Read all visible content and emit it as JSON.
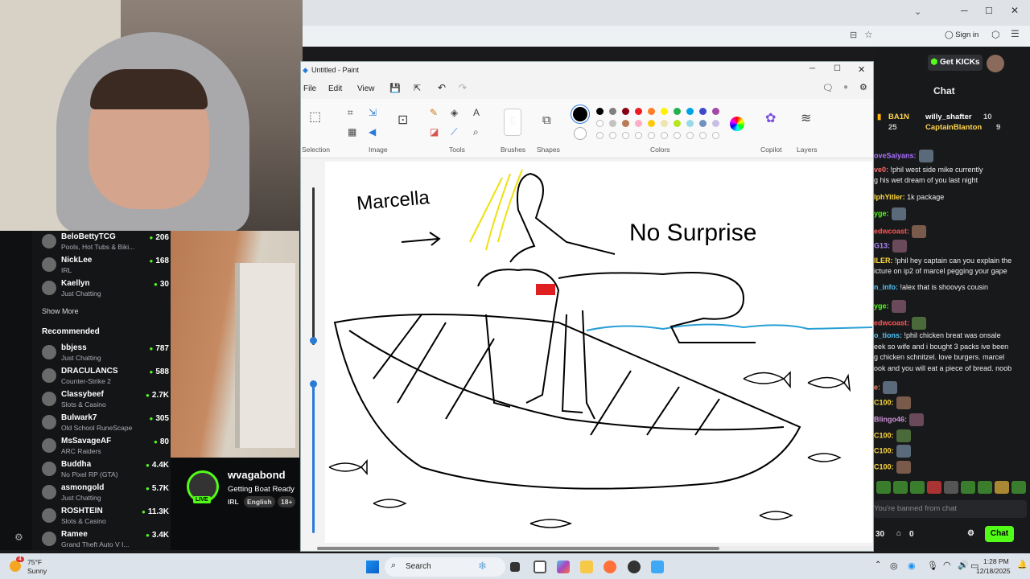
{
  "paint": {
    "window_title": "Untitled - Paint",
    "menu": [
      "File",
      "Edit",
      "View"
    ],
    "groups": [
      "Selection",
      "Image",
      "Tools",
      "Brushes",
      "Shapes",
      "Colors",
      "Copilot",
      "Layers"
    ],
    "palette": [
      "#000000",
      "#7f7f7f",
      "#880015",
      "#ed1c24",
      "#ff7f27",
      "#fff200",
      "#22b14c",
      "#00a2e8",
      "#3f48cc",
      "#a349a4",
      "#ffffff",
      "#c3c3c3",
      "#b97a57",
      "#ffaec9",
      "#ffc90e",
      "#efe4b0",
      "#b5e61d",
      "#99d9ea",
      "#7092be",
      "#c8bfe7"
    ],
    "drawing_text": [
      "Marcella",
      "No Surprise"
    ]
  },
  "browser": {
    "sign_in": "Sign in"
  },
  "kick": {
    "get_kicks": "Get KICKs",
    "chat_title": "Chat",
    "leaderboard": [
      {
        "name": "BA1N",
        "count": "25"
      },
      {
        "name": "willy_shafter",
        "count": "10"
      },
      {
        "name": "CaptainBlanton",
        "count": "9"
      }
    ],
    "messages": [
      {
        "user": "oveSaiyans:",
        "text": "",
        "color": "#a970ff"
      },
      {
        "user": "ve0:",
        "text": " !phil west side mike currently",
        "color": "#ff6b6b"
      },
      {
        "user": "",
        "text": "g his wet dream of you last night",
        "color": "#fff"
      },
      {
        "user": "lphYitler:",
        "text": " 1k package",
        "color": "#ffd93d"
      },
      {
        "user": "yge:",
        "text": "",
        "color": "#53fc18"
      },
      {
        "user": "edwcoast:",
        "text": "",
        "color": "#ff5555"
      },
      {
        "user": "G13:",
        "text": "",
        "color": "#b388ff"
      },
      {
        "user": "ILER:",
        "text": " !phil hey captain can you explain the",
        "color": "#ffd93d"
      },
      {
        "user": "",
        "text": "icture on ip2 of marcel pegging your gape",
        "color": "#fff"
      },
      {
        "user": "n_info:",
        "text": " !alex that is shoovys cousin",
        "color": "#4fc3f7"
      },
      {
        "user": "yge:",
        "text": "",
        "color": "#53fc18"
      },
      {
        "user": "edwcoast:",
        "text": "",
        "color": "#ff5555"
      },
      {
        "user": "o_tions:",
        "text": " !phil chicken breat was onsale",
        "color": "#4fc3f7"
      },
      {
        "user": "",
        "text": "eek so wife and i bought 3 packs ive been",
        "color": "#fff"
      },
      {
        "user": "",
        "text": "g chicken schnitzel. love burgers. marcel",
        "color": "#fff"
      },
      {
        "user": "",
        "text": "ook and you will eat a piece of bread. noob",
        "color": "#fff"
      },
      {
        "user": "e:",
        "text": "",
        "color": "#ff8a65"
      },
      {
        "user": "C100:",
        "text": "",
        "color": "#ffd93d"
      },
      {
        "user": "Blingo46:",
        "text": "",
        "color": "#ce93d8"
      },
      {
        "user": "C100:",
        "text": "",
        "color": "#ffd93d"
      },
      {
        "user": "C100:",
        "text": "",
        "color": "#ffd93d"
      },
      {
        "user": "C100:",
        "text": "",
        "color": "#ffd93d"
      }
    ],
    "banned_placeholder": "You're banned from chat",
    "footer_count1": "30",
    "footer_count2": "0",
    "chat_button": "Chat",
    "sidebar": {
      "following": [
        {
          "name": "BeloBettyTCG",
          "game": "Pools, Hot Tubs & Biki...",
          "viewers": "206"
        },
        {
          "name": "NickLee",
          "game": "IRL",
          "viewers": "168"
        },
        {
          "name": "Kaellyn",
          "game": "Just Chatting",
          "viewers": "30"
        }
      ],
      "show_more": "Show More",
      "recommended_title": "Recommended",
      "recommended": [
        {
          "name": "bbjess",
          "game": "Just Chatting",
          "viewers": "787"
        },
        {
          "name": "DRACULANCS",
          "game": "Counter-Strike 2",
          "viewers": "588"
        },
        {
          "name": "Classybeef",
          "game": "Slots & Casino",
          "viewers": "2.7K"
        },
        {
          "name": "Bulwark7",
          "game": "Old School RuneScape",
          "viewers": "305"
        },
        {
          "name": "MsSavageAF",
          "game": "ARC Raiders",
          "viewers": "80"
        },
        {
          "name": "Buddha",
          "game": "No Pixel RP (GTA)",
          "viewers": "4.4K"
        },
        {
          "name": "asmongold",
          "game": "Just Chatting",
          "viewers": "5.7K"
        },
        {
          "name": "ROSHTEIN",
          "game": "Slots & Casino",
          "viewers": "11.3K"
        },
        {
          "name": "Ramee",
          "game": "Grand Theft Auto V I...",
          "viewers": "3.4K"
        }
      ]
    },
    "stream": {
      "channel": "wvagabond",
      "title": "Getting Boat Ready",
      "live_badge": "LIVE",
      "tags": [
        "IRL",
        "English",
        "18+"
      ]
    }
  },
  "taskbar": {
    "weather_temp": "75°F",
    "weather_desc": "Sunny",
    "weather_badge": "4",
    "search": "Search",
    "time": "1:28 PM",
    "date": "12/18/2025"
  }
}
